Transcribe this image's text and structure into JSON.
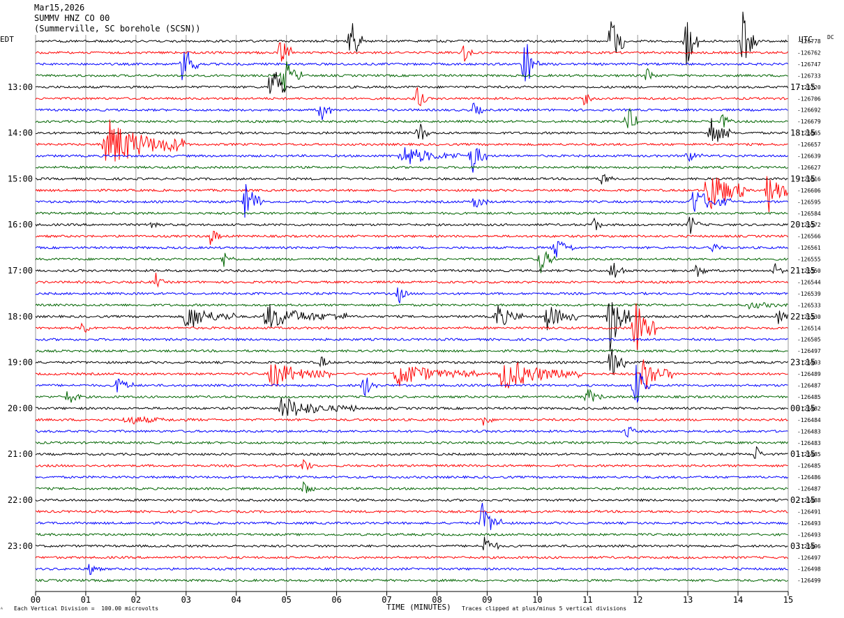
{
  "header": {
    "date": "Mar15,2026",
    "station": "SUMMV HNZ CO 00",
    "location": "(Summerville, SC borehole (SCSN))"
  },
  "left_tz": "EDT",
  "right_tz": "UTC",
  "dc_label": "DC",
  "footer": {
    "scale_note": "Each Vertical Division =  100.00 microvolts",
    "clip_note": "Traces clipped at plus/minus 5 vertical divisions",
    "corner_mark": "ᴬ"
  },
  "colors": {
    "trace_cycle": [
      "#000000",
      "#ff0000",
      "#0000ff",
      "#006400"
    ],
    "grid": "#9a9a9a"
  },
  "chart_data": {
    "type": "line",
    "title": "",
    "xlabel": "TIME (MINUTES)",
    "x_ticks": [
      "00",
      "01",
      "02",
      "03",
      "04",
      "05",
      "06",
      "07",
      "08",
      "09",
      "10",
      "11",
      "12",
      "13",
      "14",
      "15"
    ],
    "xlim": [
      0,
      15
    ],
    "left_hour_labels": [
      "13:00",
      "14:00",
      "15:00",
      "16:00",
      "17:00",
      "18:00",
      "19:00",
      "20:00",
      "21:00",
      "22:00",
      "23:00"
    ],
    "right_hour_labels": [
      "17:15",
      "18:15",
      "19:15",
      "20:15",
      "21:15",
      "22:15",
      "23:15",
      "00:15",
      "01:15",
      "02:15",
      "03:15"
    ],
    "dc_values": [
      "-126778",
      "-126762",
      "-126747",
      "-126733",
      "-126720",
      "-126706",
      "-126692",
      "-126679",
      "-126665",
      "-126657",
      "-126639",
      "-126627",
      "-126616",
      "-126606",
      "-126595",
      "-126584",
      "-126572",
      "-126566",
      "-126561",
      "-126555",
      "-126550",
      "-126544",
      "-126539",
      "-126533",
      "-126530",
      "-126514",
      "-126505",
      "-126497",
      "-126493",
      "-126489",
      "-126487",
      "-126485",
      "-126482",
      "-126484",
      "-126483",
      "-126483",
      "-126485",
      "-126485",
      "-126486",
      "-126487",
      "-126488",
      "-126491",
      "-126493",
      "-126493",
      "-126496",
      "-126497",
      "-126498",
      "-126499"
    ],
    "events": [
      {
        "trace": 0,
        "minute": 6.28,
        "amp": 45,
        "dur": 0.25
      },
      {
        "trace": 0,
        "minute": 11.48,
        "amp": 45,
        "dur": 0.25
      },
      {
        "trace": 0,
        "minute": 12.98,
        "amp": 45,
        "dur": 0.25
      },
      {
        "trace": 0,
        "minute": 14.1,
        "amp": 45,
        "dur": 0.3
      },
      {
        "trace": 1,
        "minute": 4.9,
        "amp": 30,
        "dur": 0.2
      },
      {
        "trace": 1,
        "minute": 8.55,
        "amp": 14,
        "dur": 0.15
      },
      {
        "trace": 2,
        "minute": 2.95,
        "amp": 38,
        "dur": 0.3
      },
      {
        "trace": 2,
        "minute": 9.75,
        "amp": 48,
        "dur": 0.3
      },
      {
        "trace": 3,
        "minute": 4.95,
        "amp": 30,
        "dur": 0.35
      },
      {
        "trace": 3,
        "minute": 12.2,
        "amp": 14,
        "dur": 0.2
      },
      {
        "trace": 4,
        "minute": 4.7,
        "amp": 45,
        "dur": 0.3
      },
      {
        "trace": 5,
        "minute": 7.6,
        "amp": 24,
        "dur": 0.2
      },
      {
        "trace": 5,
        "minute": 10.95,
        "amp": 14,
        "dur": 0.15
      },
      {
        "trace": 6,
        "minute": 5.7,
        "amp": 22,
        "dur": 0.2
      },
      {
        "trace": 6,
        "minute": 8.75,
        "amp": 16,
        "dur": 0.2
      },
      {
        "trace": 7,
        "minute": 11.8,
        "amp": 30,
        "dur": 0.2
      },
      {
        "trace": 7,
        "minute": 13.7,
        "amp": 14,
        "dur": 0.2
      },
      {
        "trace": 8,
        "minute": 7.65,
        "amp": 22,
        "dur": 0.2
      },
      {
        "trace": 8,
        "minute": 13.45,
        "amp": 30,
        "dur": 0.4
      },
      {
        "trace": 9,
        "minute": 1.4,
        "amp": 40,
        "dur": 1.6
      },
      {
        "trace": 10,
        "minute": 7.3,
        "amp": 18,
        "dur": 1.2
      },
      {
        "trace": 10,
        "minute": 8.7,
        "amp": 30,
        "dur": 0.3
      },
      {
        "trace": 10,
        "minute": 13.0,
        "amp": 12,
        "dur": 0.3
      },
      {
        "trace": 12,
        "minute": 11.3,
        "amp": 14,
        "dur": 0.2
      },
      {
        "trace": 13,
        "minute": 13.4,
        "amp": 40,
        "dur": 0.8
      },
      {
        "trace": 13,
        "minute": 14.6,
        "amp": 35,
        "dur": 0.5
      },
      {
        "trace": 14,
        "minute": 4.2,
        "amp": 36,
        "dur": 0.35
      },
      {
        "trace": 14,
        "minute": 8.75,
        "amp": 14,
        "dur": 0.3
      },
      {
        "trace": 14,
        "minute": 13.1,
        "amp": 22,
        "dur": 0.8
      },
      {
        "trace": 16,
        "minute": 2.35,
        "amp": 16,
        "dur": 0.15
      },
      {
        "trace": 16,
        "minute": 11.15,
        "amp": 16,
        "dur": 0.15
      },
      {
        "trace": 16,
        "minute": 13.05,
        "amp": 18,
        "dur": 0.2
      },
      {
        "trace": 17,
        "minute": 3.5,
        "amp": 18,
        "dur": 0.2
      },
      {
        "trace": 18,
        "minute": 10.35,
        "amp": 20,
        "dur": 0.4
      },
      {
        "trace": 18,
        "minute": 13.5,
        "amp": 10,
        "dur": 0.2
      },
      {
        "trace": 19,
        "minute": 3.75,
        "amp": 14,
        "dur": 0.2
      },
      {
        "trace": 19,
        "minute": 10.05,
        "amp": 26,
        "dur": 0.3
      },
      {
        "trace": 20,
        "minute": 13.2,
        "amp": 16,
        "dur": 0.2
      },
      {
        "trace": 20,
        "minute": 14.75,
        "amp": 14,
        "dur": 0.15
      },
      {
        "trace": 20,
        "minute": 11.5,
        "amp": 20,
        "dur": 0.3
      },
      {
        "trace": 21,
        "minute": 2.4,
        "amp": 14,
        "dur": 0.15
      },
      {
        "trace": 22,
        "minute": 7.25,
        "amp": 16,
        "dur": 0.2
      },
      {
        "trace": 23,
        "minute": 14.2,
        "amp": 6,
        "dur": 1.5
      },
      {
        "trace": 24,
        "minute": 3.0,
        "amp": 22,
        "dur": 1.0
      },
      {
        "trace": 24,
        "minute": 4.6,
        "amp": 20,
        "dur": 1.6
      },
      {
        "trace": 24,
        "minute": 9.2,
        "amp": 22,
        "dur": 0.5
      },
      {
        "trace": 24,
        "minute": 10.2,
        "amp": 22,
        "dur": 0.6
      },
      {
        "trace": 24,
        "minute": 11.45,
        "amp": 55,
        "dur": 0.4
      },
      {
        "trace": 24,
        "minute": 14.8,
        "amp": 14,
        "dur": 0.3
      },
      {
        "trace": 25,
        "minute": 0.95,
        "amp": 18,
        "dur": 0.15
      },
      {
        "trace": 25,
        "minute": 11.95,
        "amp": 50,
        "dur": 0.4
      },
      {
        "trace": 28,
        "minute": 5.7,
        "amp": 12,
        "dur": 0.2
      },
      {
        "trace": 28,
        "minute": 11.45,
        "amp": 30,
        "dur": 0.3
      },
      {
        "trace": 29,
        "minute": 4.7,
        "amp": 22,
        "dur": 1.2
      },
      {
        "trace": 29,
        "minute": 7.2,
        "amp": 20,
        "dur": 1.6
      },
      {
        "trace": 29,
        "minute": 9.3,
        "amp": 26,
        "dur": 1.6
      },
      {
        "trace": 29,
        "minute": 12.1,
        "amp": 30,
        "dur": 0.6
      },
      {
        "trace": 30,
        "minute": 1.65,
        "amp": 18,
        "dur": 0.3
      },
      {
        "trace": 30,
        "minute": 6.55,
        "amp": 20,
        "dur": 0.3
      },
      {
        "trace": 30,
        "minute": 11.95,
        "amp": 40,
        "dur": 0.3
      },
      {
        "trace": 31,
        "minute": 0.65,
        "amp": 14,
        "dur": 0.3
      },
      {
        "trace": 31,
        "minute": 11.0,
        "amp": 16,
        "dur": 0.3
      },
      {
        "trace": 32,
        "minute": 4.9,
        "amp": 18,
        "dur": 1.5
      },
      {
        "trace": 33,
        "minute": 1.8,
        "amp": 8,
        "dur": 1.5
      },
      {
        "trace": 33,
        "minute": 8.95,
        "amp": 14,
        "dur": 0.15
      },
      {
        "trace": 34,
        "minute": 11.8,
        "amp": 14,
        "dur": 0.2
      },
      {
        "trace": 36,
        "minute": 14.35,
        "amp": 18,
        "dur": 0.15
      },
      {
        "trace": 37,
        "minute": 5.35,
        "amp": 16,
        "dur": 0.2
      },
      {
        "trace": 39,
        "minute": 5.35,
        "amp": 14,
        "dur": 0.2
      },
      {
        "trace": 42,
        "minute": 8.9,
        "amp": 30,
        "dur": 0.4
      },
      {
        "trace": 44,
        "minute": 8.95,
        "amp": 18,
        "dur": 0.3
      },
      {
        "trace": 46,
        "minute": 1.1,
        "amp": 14,
        "dur": 0.2
      }
    ]
  }
}
